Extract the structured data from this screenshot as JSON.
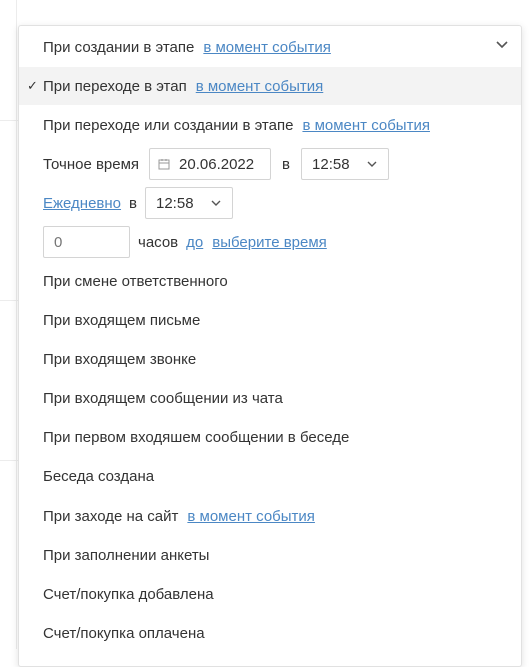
{
  "menu": {
    "row1": {
      "label": "При создании в этапе",
      "link": "в момент события"
    },
    "row2": {
      "label": "При переходе в этап",
      "link": "в момент события",
      "check": "✓"
    },
    "row3": {
      "label": "При переходе или создании в этапе",
      "link": "в момент события"
    },
    "row4": {
      "label": "Точное время",
      "date": "20.06.2022",
      "sep": "в",
      "time": "12:58"
    },
    "row5": {
      "link": "Ежедневно",
      "sep": "в",
      "time": "12:58"
    },
    "row6": {
      "placeholder": "0",
      "label": "часов",
      "link1": "до",
      "link2": "выберите время"
    },
    "row7": {
      "label": "При смене ответственного"
    },
    "row8": {
      "label": "При входящем письме"
    },
    "row9": {
      "label": "При входящем звонке"
    },
    "row10": {
      "label": "При входящем сообщении из чата"
    },
    "row11": {
      "label": "При первом входяшем сообщении в беседе"
    },
    "row12": {
      "label": "Беседа создана"
    },
    "row13": {
      "label": "При заходе на сайт",
      "link": "в момент события"
    },
    "row14": {
      "label": "При заполнении анкеты"
    },
    "row15": {
      "label": "Счет/покупка добавлена"
    },
    "row16": {
      "label": "Счет/покупка оплачена"
    }
  },
  "colors": {
    "link": "#4b87c4",
    "selected_bg": "#f3f3f3",
    "text": "#333333"
  }
}
